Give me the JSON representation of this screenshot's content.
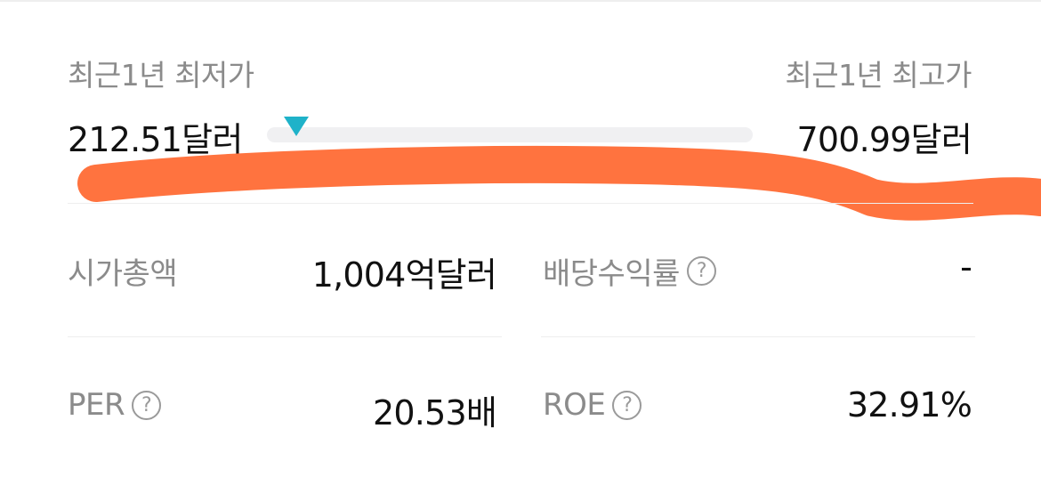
{
  "price_range": {
    "low_label": "최근1년 최저가",
    "high_label": "최근1년 최고가",
    "low_value": "212.51달러",
    "high_value": "700.99달러",
    "current_position_fraction": 0.06,
    "marker_color": "#1fb2c9"
  },
  "stats": {
    "market_cap": {
      "label": "시가총액",
      "value": "1,004억달러"
    },
    "dividend_yield": {
      "label": "배당수익률",
      "value": "-",
      "help_icon": "question-circle-icon"
    },
    "per": {
      "label": "PER",
      "value": "20.53배",
      "help_icon": "question-circle-icon"
    },
    "roe": {
      "label": "ROE",
      "value": "32.91%",
      "help_icon": "question-circle-icon"
    }
  },
  "help_icon_glyph": "?",
  "annotation": {
    "color": "#ff6b35"
  }
}
